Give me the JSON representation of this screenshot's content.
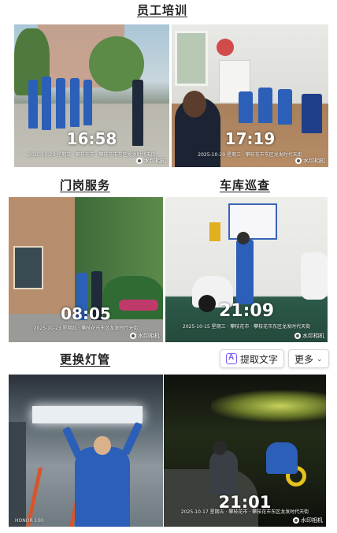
{
  "sections": {
    "training": "员工培训",
    "gate": "门岗服务",
    "garage": "车库巡查",
    "lights": "更换灯管"
  },
  "photos": {
    "p1": {
      "time": "16:58",
      "caption": "2025-10-29 星期三 · 攀枝花市 · 攀枝花市东区龙发时代天街"
    },
    "p2": {
      "time": "17:19",
      "caption": "2025-10-29 星期三 · 攀枝花市东区龙发时代天街"
    },
    "p3": {
      "time": "08:05",
      "caption": "2025-10-23 星期四 · 攀枝花市东区龙发时代天街"
    },
    "p4": {
      "time": "21:09",
      "caption": "2025-10-15 星期三 · 攀枝花市 · 攀枝花市东区龙发时代天街"
    },
    "p6": {
      "time": "21:01",
      "caption": "2025-10-17 星期五 · 攀枝花市 · 攀枝花市东区龙发时代天街"
    },
    "p5_brand": "HONOR 100"
  },
  "watermark": "水印相机",
  "toolbar": {
    "extract_text": "提取文字",
    "more": "更多"
  },
  "colors": {
    "uniform": "#2b5fb8",
    "heading": "#222222"
  }
}
